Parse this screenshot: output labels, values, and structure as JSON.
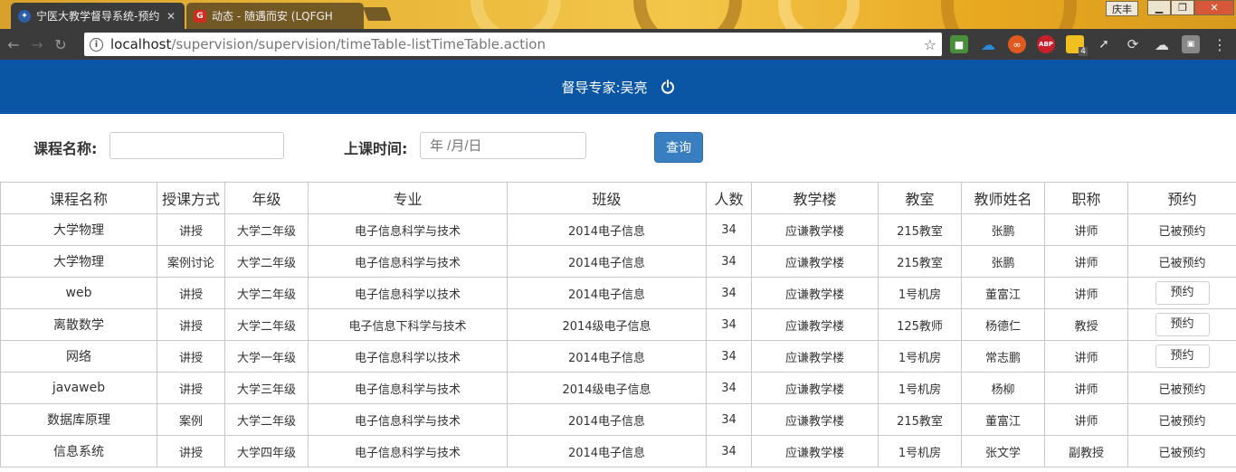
{
  "browser": {
    "tabs": [
      {
        "title": "宁医大教学督导系统-预约"
      },
      {
        "title": "动态 - 随遇而安 (LQFGH"
      }
    ],
    "user_label": "庆丰",
    "url_host": "localhost",
    "url_path": "/supervision/supervision/timeTable-listTimeTable.action",
    "extensions": [
      {
        "name": "chrome-color-icon",
        "color": "#4a8f3c"
      },
      {
        "name": "cloud-icon",
        "color": "#2a8ad6"
      },
      {
        "name": "infinity-icon",
        "color": "#e05a20"
      },
      {
        "name": "adblock-icon",
        "color": "#c8202a",
        "label": "ABP"
      },
      {
        "name": "note-icon",
        "color": "#f0c020",
        "badge": "4"
      },
      {
        "name": "cursor-icon",
        "color": "#3b3b3b"
      },
      {
        "name": "sync-icon",
        "color": "#3b3b3b"
      },
      {
        "name": "cloud-white-icon",
        "color": "#3b3b3b"
      },
      {
        "name": "pocket-icon",
        "color": "#888888"
      }
    ]
  },
  "header": {
    "user_text": "督导专家:吴亮"
  },
  "search": {
    "course_label": "课程名称:",
    "course_value": "",
    "time_label": "上课时间:",
    "time_placeholder": "年 /月/日",
    "query_button": "查询"
  },
  "table": {
    "headers": [
      "课程名称",
      "授课方式",
      "年级",
      "专业",
      "班级",
      "人数",
      "教学楼",
      "教室",
      "教师姓名",
      "职称",
      "预约"
    ],
    "rows": [
      {
        "course": "大学物理",
        "mode": "讲授",
        "grade": "大学二年级",
        "major": "电子信息科学与技术",
        "class": "2014电子信息",
        "count": "34",
        "building": "应谦教学楼",
        "room": "215教室",
        "teacher": "张鹏",
        "title": "讲师",
        "reserve": "已被预约",
        "reservable": false
      },
      {
        "course": "大学物理",
        "mode": "案例讨论",
        "grade": "大学二年级",
        "major": "电子信息科学与技术",
        "class": "2014电子信息",
        "count": "34",
        "building": "应谦教学楼",
        "room": "215教室",
        "teacher": "张鹏",
        "title": "讲师",
        "reserve": "已被预约",
        "reservable": false
      },
      {
        "course": "web",
        "mode": "讲授",
        "grade": "大学二年级",
        "major": "电子信息科学以技术",
        "class": "2014电子信息",
        "count": "34",
        "building": "应谦教学楼",
        "room": "1号机房",
        "teacher": "董富江",
        "title": "讲师",
        "reserve": "预约",
        "reservable": true
      },
      {
        "course": "离散数学",
        "mode": "讲授",
        "grade": "大学二年级",
        "major": "电子信息下科学与技术",
        "class": "2014级电子信息",
        "count": "34",
        "building": "应谦教学楼",
        "room": "125教师",
        "teacher": "杨德仁",
        "title": "教授",
        "reserve": "预约",
        "reservable": true
      },
      {
        "course": "网络",
        "mode": "讲授",
        "grade": "大学一年级",
        "major": "电子信息科学以技术",
        "class": "2014电子信息",
        "count": "34",
        "building": "应谦教学楼",
        "room": "1号机房",
        "teacher": "常志鹏",
        "title": "讲师",
        "reserve": "预约",
        "reservable": true
      },
      {
        "course": "javaweb",
        "mode": "讲授",
        "grade": "大学三年级",
        "major": "电子信息科学与技术",
        "class": "2014级电子信息",
        "count": "34",
        "building": "应谦教学楼",
        "room": "1号机房",
        "teacher": "杨柳",
        "title": "讲师",
        "reserve": "已被预约",
        "reservable": false
      },
      {
        "course": "数据库原理",
        "mode": "案例",
        "grade": "大学二年级",
        "major": "电子信息科学与技术",
        "class": "2014电子信息",
        "count": "34",
        "building": "应谦教学楼",
        "room": "215教室",
        "teacher": "董富江",
        "title": "讲师",
        "reserve": "已被预约",
        "reservable": false
      },
      {
        "course": "信息系统",
        "mode": "讲授",
        "grade": "大学四年级",
        "major": "电子信息科学与技术",
        "class": "2014电子信息",
        "count": "34",
        "building": "应谦教学楼",
        "room": "1号机房",
        "teacher": "张文学",
        "title": "副教授",
        "reserve": "已被预约",
        "reservable": false
      }
    ]
  }
}
